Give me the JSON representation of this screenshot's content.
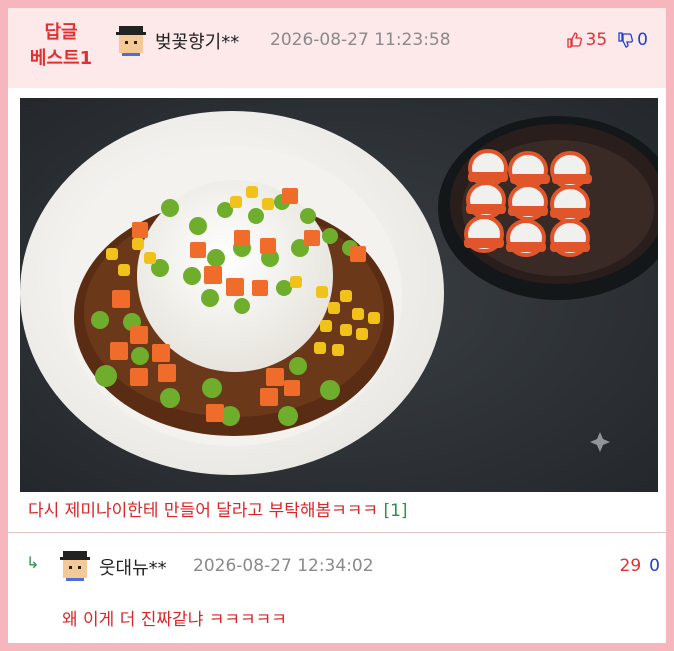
{
  "best_comment": {
    "badge_line1": "답글",
    "badge_line2": "베스트1",
    "author": "벚꽃향기**",
    "date": "2026-08-27 11:23:58",
    "upvotes": "35",
    "downvotes": "0",
    "text": "다시 제미나이한테 만들어 달라고 부탁해봄ㅋㅋㅋ",
    "reply_count": "[1]",
    "image_icon": "curry-rice-photo"
  },
  "reply": {
    "arrow": "↳",
    "author": "웃대뉴**",
    "date": "2026-08-27 12:34:02",
    "upvotes": "29",
    "downvotes": "0",
    "text": "왜 이게 더 진짜같냐 ㅋㅋㅋㅋㅋ"
  },
  "colors": {
    "accent_red": "#e03131",
    "down_blue": "#1c3fd6",
    "border_pink": "#f7b6bd",
    "reply_green": "#2b9348"
  }
}
